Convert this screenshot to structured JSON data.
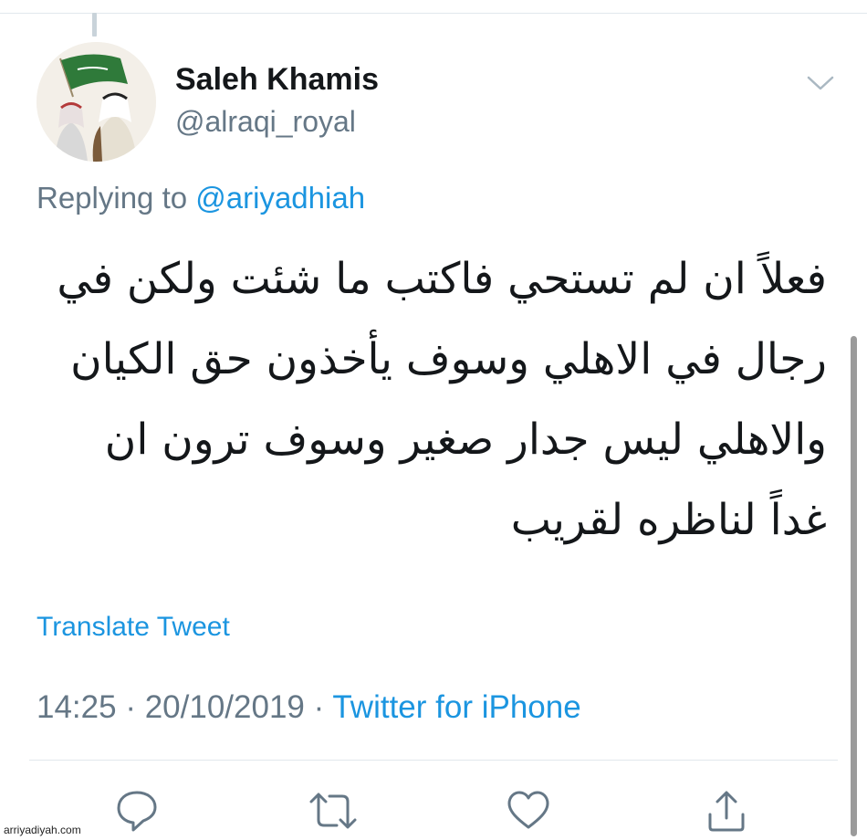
{
  "author": {
    "display_name": "Saleh Khamis",
    "handle": "@alraqi_royal"
  },
  "reply": {
    "prefix": "Replying to",
    "mention": "@ariyadhiah"
  },
  "tweet": {
    "lines": [
      "فعلاً ان لم تستحي فاكتب ما شئت ولكن في",
      "رجال في الاهلي وسوف يأخذون حق الكيان",
      "والاهلي ليس جدار صغير وسوف ترون ان",
      "غداً لناظره لقريب"
    ]
  },
  "translate_label": "Translate Tweet",
  "meta": {
    "time": "14:25",
    "separator": " · ",
    "date": "20/10/2019",
    "source": "Twitter for iPhone"
  },
  "actions": {
    "reply_icon": "reply-icon",
    "retweet_icon": "retweet-icon",
    "like_icon": "like-icon",
    "share_icon": "share-icon"
  },
  "watermark": "arriyadiyah.com",
  "colors": {
    "link": "#1b95e0",
    "muted": "#657786",
    "text": "#14171a",
    "divider": "#e1e8ed"
  }
}
